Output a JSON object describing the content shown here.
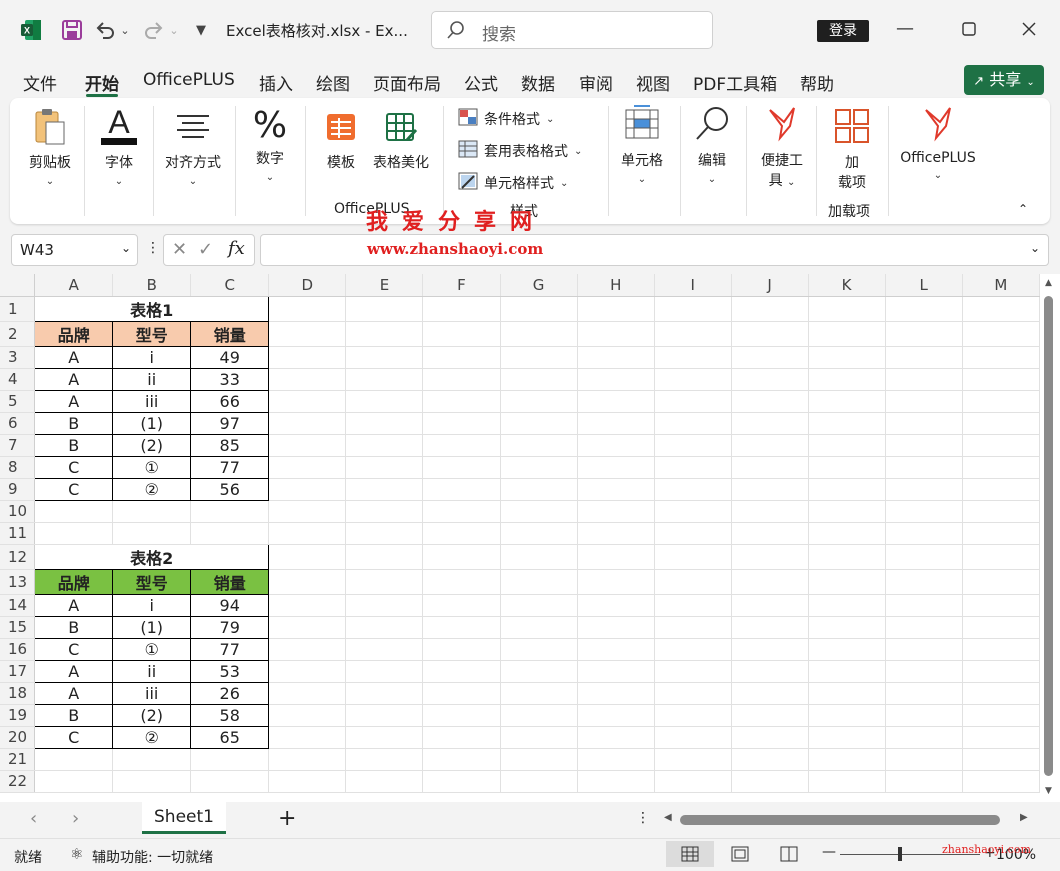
{
  "title_bar": {
    "filename": "Excel表格核对.xlsx  -  Ex...",
    "search_placeholder": "搜索",
    "login_label": "登录"
  },
  "menu": {
    "items": [
      "文件",
      "开始",
      "OfficePLUS",
      "插入",
      "绘图",
      "页面布局",
      "公式",
      "数据",
      "审阅",
      "视图",
      "PDF工具箱",
      "帮助"
    ],
    "active": "开始",
    "share_label": "共享"
  },
  "ribbon": {
    "clipboard": "剪贴板",
    "font": "字体",
    "alignment": "对齐方式",
    "number": "数字",
    "template": "模板",
    "table_beautify": "表格美化",
    "officeplus_group": "OfficePLUS",
    "conditional_format": "条件格式",
    "format_as_table": "套用表格格式",
    "cell_styles": "单元格样式",
    "styles_group": "样式",
    "cells": "单元格",
    "editing": "编辑",
    "quick_tools_1": "便捷工",
    "quick_tools_2": "具",
    "addins_1": "加",
    "addins_2": "载项",
    "addins_group": "加载项",
    "officeplus_btn": "OfficePLUS"
  },
  "formula_bar": {
    "name_box": "W43",
    "fx": "fx",
    "formula": ""
  },
  "watermark": {
    "line1": "我爱分享网",
    "line2": "www.zhanshaoyi.com",
    "status": "zhanshaoyi.com"
  },
  "sheet": {
    "columns": [
      "A",
      "B",
      "C",
      "D",
      "E",
      "F",
      "G",
      "H",
      "I",
      "J",
      "K",
      "L",
      "M"
    ],
    "table1_title": "表格1",
    "table1_headers": [
      "品牌",
      "型号",
      "销量"
    ],
    "table1_rows": [
      [
        "A",
        "i",
        "49"
      ],
      [
        "A",
        "ii",
        "33"
      ],
      [
        "A",
        "iii",
        "66"
      ],
      [
        "B",
        "(1)",
        "97"
      ],
      [
        "B",
        "(2)",
        "85"
      ],
      [
        "C",
        "①",
        "77"
      ],
      [
        "C",
        "②",
        "56"
      ]
    ],
    "table2_title": "表格2",
    "table2_headers": [
      "品牌",
      "型号",
      "销量"
    ],
    "table2_rows": [
      [
        "A",
        "i",
        "94"
      ],
      [
        "B",
        "(1)",
        "79"
      ],
      [
        "C",
        "①",
        "77"
      ],
      [
        "A",
        "ii",
        "53"
      ],
      [
        "A",
        "iii",
        "26"
      ],
      [
        "B",
        "(2)",
        "58"
      ],
      [
        "C",
        "②",
        "65"
      ]
    ]
  },
  "tabs": {
    "sheet1": "Sheet1",
    "add": "+"
  },
  "status": {
    "ready": "就绪",
    "accessibility": "辅助功能: 一切就绪",
    "zoom": "100%"
  },
  "colors": {
    "excel_green": "#1e7145",
    "table1_header": "#f8cbad",
    "table2_header": "#7ac142",
    "watermark_red": "#e02020"
  }
}
